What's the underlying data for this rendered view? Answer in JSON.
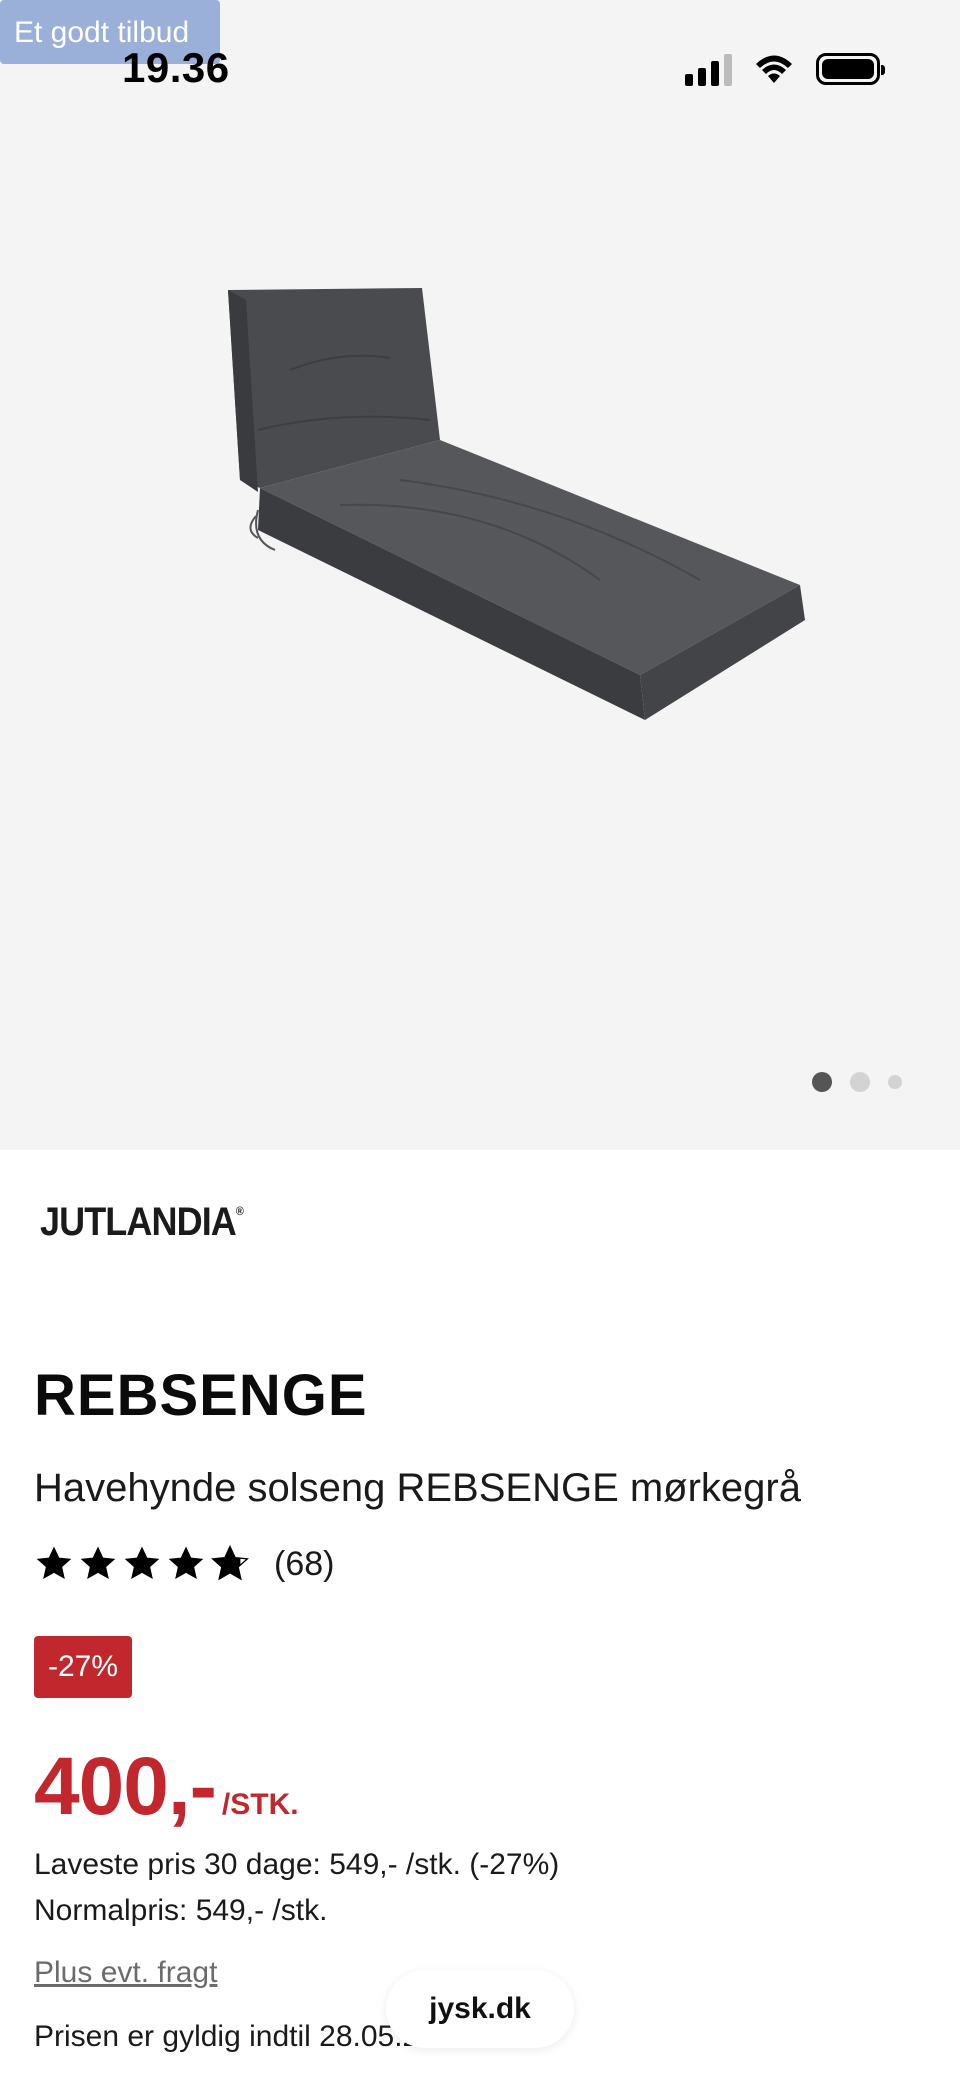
{
  "status_bar": {
    "time": "19.36",
    "icons": [
      "signal-icon",
      "wifi-icon",
      "battery-icon"
    ]
  },
  "offer_badge": "Et godt tilbud",
  "carousel": {
    "count": 3,
    "active_index": 0
  },
  "brand": {
    "name": "JUTLANDIA",
    "mark": "®"
  },
  "product": {
    "title": "REBSENGE",
    "subtitle": "Havehynde solseng REBSENGE mørkegrå",
    "rating": 4.5,
    "review_count": "(68)",
    "discount": "-27%",
    "price": "400,-",
    "price_unit": "/STK.",
    "lowest_price": "Laveste pris 30 dage: 549,- /stk. (-27%)",
    "normal_price": "Normalpris: 549,- /stk.",
    "shipping_link": "Plus evt. fragt",
    "valid_until": "Prisen er gyldig indtil 28.05.2023"
  },
  "browser": {
    "url": "jysk.dk"
  },
  "colors": {
    "accent_red": "#c1272d",
    "badge_blue": "#9ab0d8",
    "hero_bg": "#f4f4f4"
  }
}
